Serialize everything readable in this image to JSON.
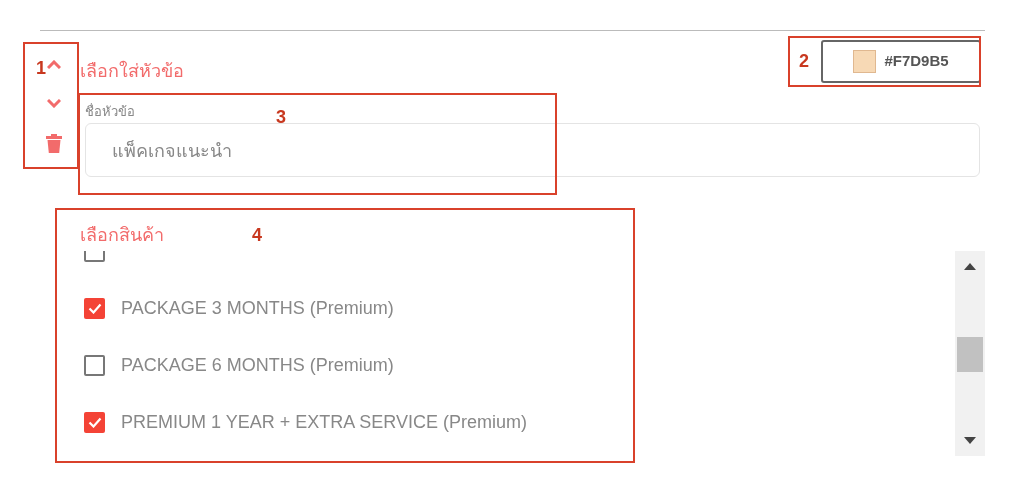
{
  "section": {
    "title": "เลือกใส่หัวข้อ",
    "color_picker": {
      "color": "#f7d9b5",
      "value": "#F7D9B5"
    }
  },
  "topic_field": {
    "label": "ชื่อหัวข้อ",
    "value": "แพ็คเกจแนะนำ"
  },
  "products": {
    "title": "เลือกสินค้า",
    "items": [
      {
        "checked": false
      },
      {
        "label": "PACKAGE 3 MONTHS (Premium)",
        "checked": true
      },
      {
        "label": "PACKAGE 6 MONTHS (Premium)",
        "checked": false
      },
      {
        "label": "PREMIUM 1 YEAR + EXTRA SERVICE (Premium)",
        "checked": true
      }
    ]
  },
  "annotations": [
    {
      "label": "1"
    },
    {
      "label": "2"
    },
    {
      "label": "3"
    },
    {
      "label": "4"
    }
  ]
}
